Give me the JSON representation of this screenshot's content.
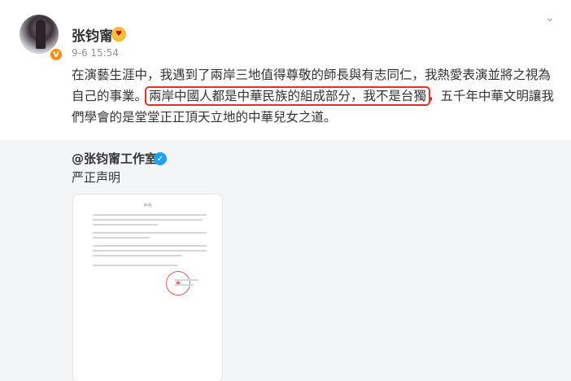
{
  "post": {
    "username": "张钧甯",
    "timestamp": "9-6 15:54",
    "more_icon": "chevron-down-icon",
    "avatar_badge_icon": "verified-v-orange-icon",
    "emoji_badge_icon": "heart-eyes-emoji-icon",
    "content_before": "在演藝生涯中，我遇到了兩岸三地值得尊敬的師長與有志同仁，我熱愛表演並將之視為自己的事業。",
    "content_highlight": "兩岸中國人都是中華民族的組成部分，我不是台獨",
    "content_after": "，五千年中華文明讓我們學會的是堂堂正正頂天立地的中華兒女之道。",
    "highlight_color": "#e53030"
  },
  "repost": {
    "username": "@张钧甯工作室",
    "verified_icon": "verified-blue-icon",
    "text": "严正声明",
    "document": {
      "title": "声明",
      "seal_icon": "red-seal-stamp-icon"
    }
  }
}
